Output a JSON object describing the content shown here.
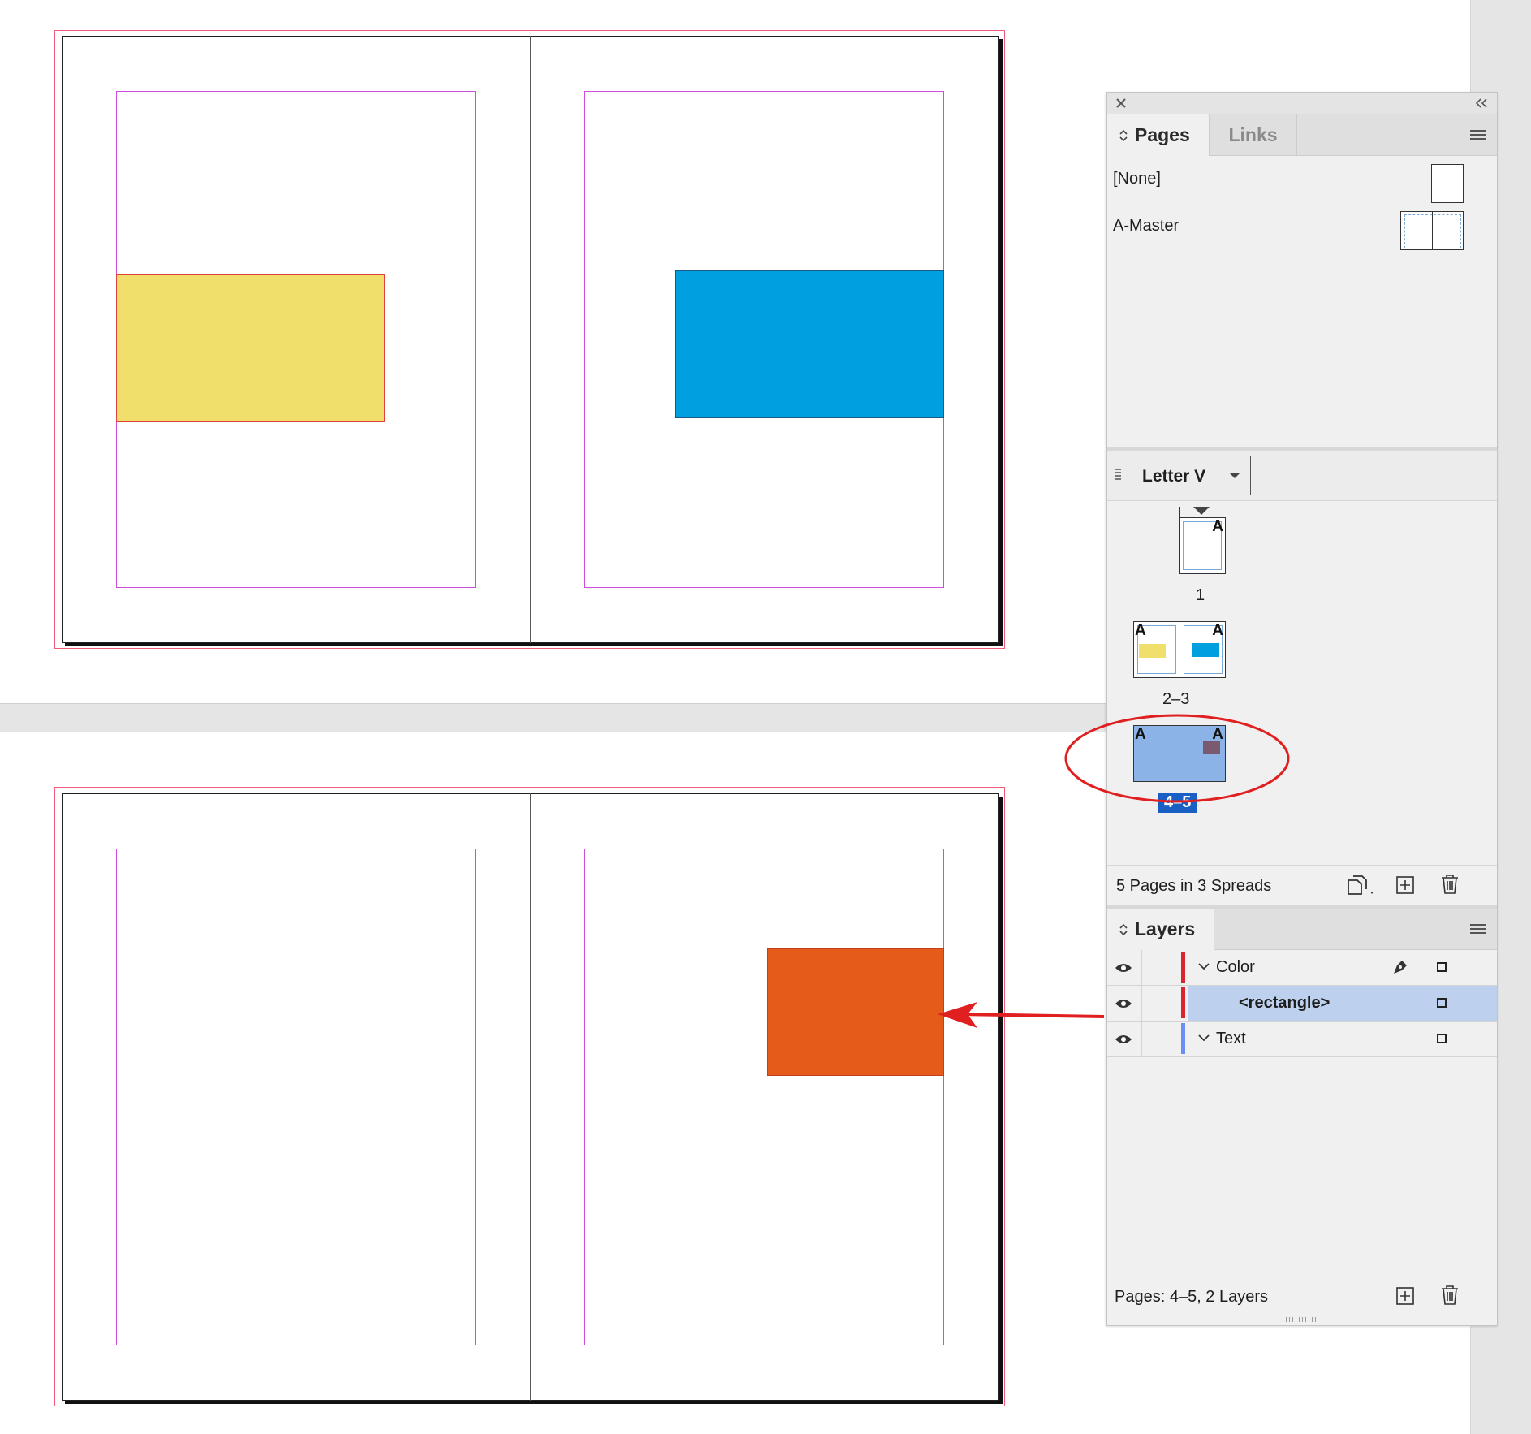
{
  "document": {
    "spread_top": {
      "left_rect_color": "#f0df6a",
      "right_rect_color": "#00a0df"
    },
    "spread_bottom": {
      "right_rect_color": "#e55c1a"
    },
    "annotation_color": "#e02020"
  },
  "pages_panel": {
    "tabs": [
      {
        "label": "Pages",
        "active": true
      },
      {
        "label": "Links",
        "active": false
      }
    ],
    "masters": [
      {
        "label": "[None]"
      },
      {
        "label": "A-Master"
      }
    ],
    "page_size": "Letter V",
    "spreads": [
      {
        "label": "1",
        "master_badge": "A"
      },
      {
        "label": "2–3",
        "master_badge": "A"
      },
      {
        "label": "4–5",
        "master_badge": "A",
        "selected": true
      }
    ],
    "status": "5 Pages in 3 Spreads",
    "selection_color": "#8cb3e8"
  },
  "layers_panel": {
    "tab_label": "Layers",
    "layers": [
      {
        "name": "Color",
        "color": "#d9262e",
        "expanded": true
      },
      {
        "name": "<rectangle>",
        "color": "#d9262e",
        "is_child": true,
        "selected": true
      },
      {
        "name": "Text",
        "color": "#6a8ff2",
        "expanded": true
      }
    ],
    "status": "Pages: 4–5, 2 Layers",
    "selection_color": "#bdd1ee"
  }
}
